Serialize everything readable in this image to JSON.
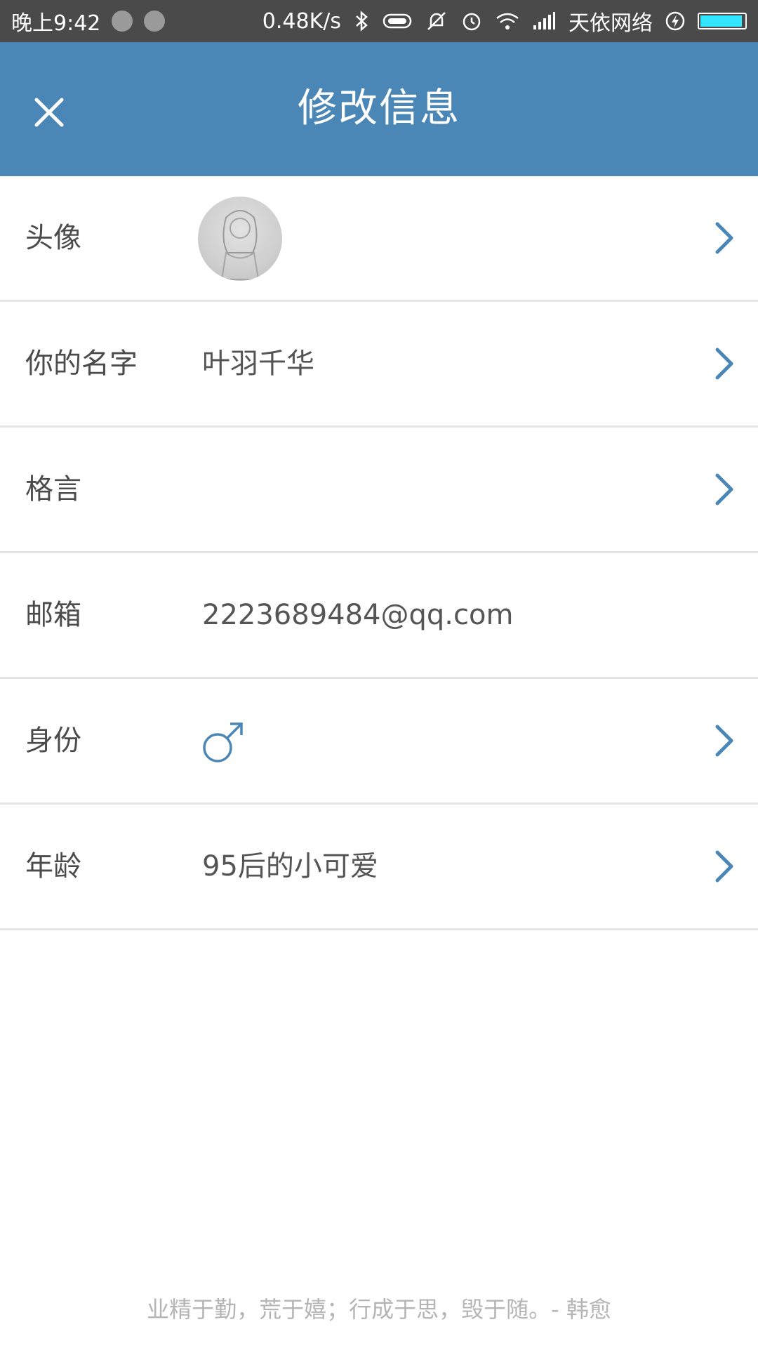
{
  "status_bar": {
    "time": "晚上9:42",
    "network_speed": "0.48K/s",
    "carrier": "天依网络",
    "battery_color": "#33e5ff",
    "battery_level": 0.95,
    "icons": [
      "notification-app-icon",
      "notification-app-icon",
      "bluetooth-icon",
      "vibrate-icon",
      "silent-icon",
      "alarm-icon",
      "wifi-icon",
      "signal-icon",
      "charging-icon",
      "battery-icon"
    ]
  },
  "app_bar": {
    "title": "修改信息",
    "close_icon": "close-icon",
    "background_color": "#4a87b6"
  },
  "rows": [
    {
      "label": "头像",
      "value": "",
      "has_arrow": true,
      "type": "avatar"
    },
    {
      "label": "你的名字",
      "value": "叶羽千华",
      "has_arrow": true
    },
    {
      "label": "格言",
      "value": "",
      "has_arrow": true
    },
    {
      "label": "邮箱",
      "value": "2223689484@qq.com",
      "has_arrow": false
    },
    {
      "label": "身份",
      "value": "",
      "has_arrow": true,
      "type": "gender",
      "gender_icon": "male-symbol-icon"
    },
    {
      "label": "年龄",
      "value": "95后的小可爱",
      "has_arrow": true
    }
  ],
  "accent_color": "#4a87b6",
  "footer": {
    "quote": "业精于勤，荒于嬉；行成于思，毁于随。- 韩愈"
  }
}
